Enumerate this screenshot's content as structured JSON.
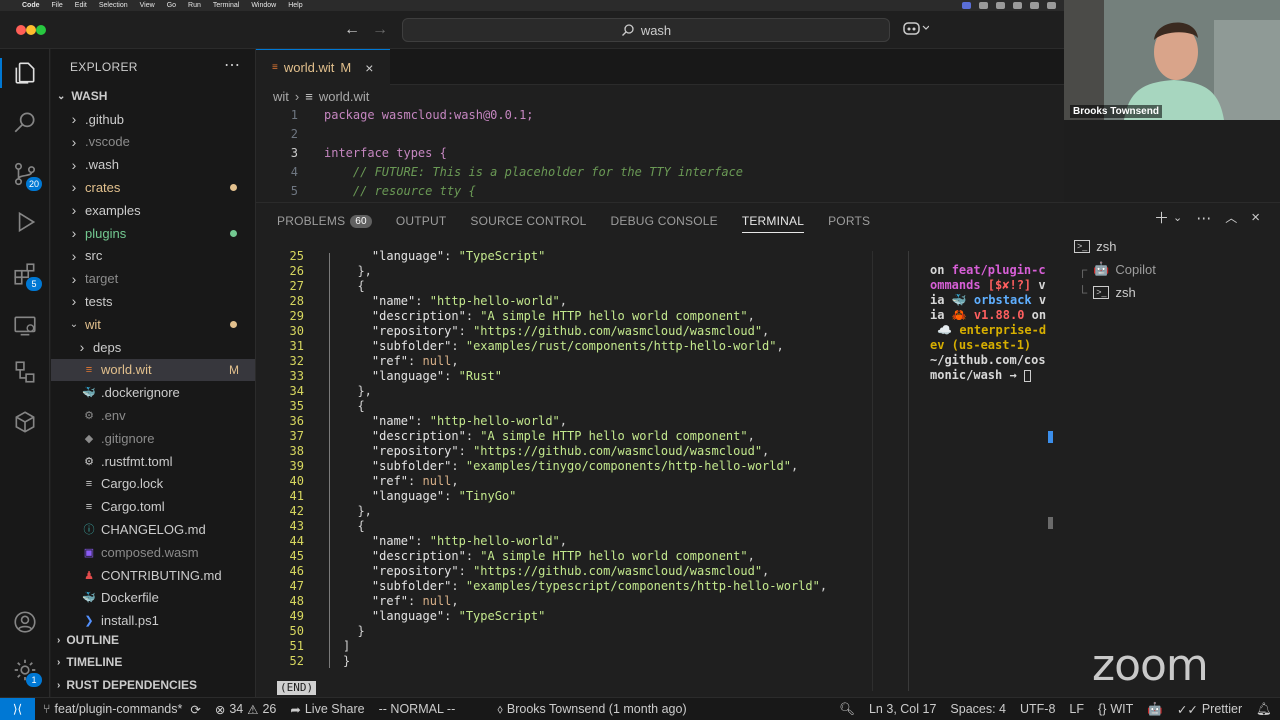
{
  "menubar": {
    "items": [
      "Code",
      "File",
      "Edit",
      "Selection",
      "View",
      "Go",
      "Run",
      "Terminal",
      "Window",
      "Help"
    ]
  },
  "titlebar": {
    "search_text": "wash"
  },
  "activity": {
    "source_control_badge": "20",
    "extensions_badge": "5",
    "manage_badge": "1"
  },
  "sidebar": {
    "title": "EXPLORER",
    "root": "WASH",
    "items": [
      {
        "label": ".github",
        "type": "folder",
        "color": "#cccccc"
      },
      {
        "label": ".vscode",
        "type": "folder",
        "color": "#8b8b8b"
      },
      {
        "label": ".wash",
        "type": "folder",
        "color": "#cccccc"
      },
      {
        "label": "crates",
        "type": "folder",
        "color": "#e2c08d"
      },
      {
        "label": "examples",
        "type": "folder",
        "color": "#cccccc"
      },
      {
        "label": "plugins",
        "type": "folder",
        "color": "#73c991"
      },
      {
        "label": "src",
        "type": "folder",
        "color": "#cccccc"
      },
      {
        "label": "target",
        "type": "folder",
        "color": "#8b8b8b"
      },
      {
        "label": "tests",
        "type": "folder",
        "color": "#cccccc"
      },
      {
        "label": "wit",
        "type": "folder-open",
        "color": "#e2c08d"
      },
      {
        "label": "deps",
        "type": "folder",
        "color": "#cccccc"
      },
      {
        "label": "world.wit",
        "type": "file",
        "color": "#e2c08d",
        "mark": "M"
      },
      {
        "label": ".dockerignore",
        "type": "file",
        "color": "#cccccc"
      },
      {
        "label": ".env",
        "type": "file",
        "color": "#8b8b8b"
      },
      {
        "label": ".gitignore",
        "type": "file",
        "color": "#8b8b8b"
      },
      {
        "label": ".rustfmt.toml",
        "type": "file",
        "color": "#cccccc"
      },
      {
        "label": "Cargo.lock",
        "type": "file",
        "color": "#cccccc"
      },
      {
        "label": "Cargo.toml",
        "type": "file",
        "color": "#cccccc"
      },
      {
        "label": "CHANGELOG.md",
        "type": "file",
        "color": "#cccccc"
      },
      {
        "label": "composed.wasm",
        "type": "file",
        "color": "#8b8b8b"
      },
      {
        "label": "CONTRIBUTING.md",
        "type": "file",
        "color": "#cccccc"
      },
      {
        "label": "Dockerfile",
        "type": "file",
        "color": "#cccccc"
      },
      {
        "label": "install.ps1",
        "type": "file",
        "color": "#cccccc"
      }
    ],
    "sections": [
      "OUTLINE",
      "TIMELINE",
      "RUST DEPENDENCIES"
    ]
  },
  "editor": {
    "tab_label": "world.wit",
    "tab_mark": "M",
    "breadcrumb": [
      "wit",
      "world.wit"
    ],
    "lines": [
      {
        "n": "1",
        "code": "package wasmcloud:wash@0.0.1;"
      },
      {
        "n": "2",
        "code": ""
      },
      {
        "n": "3",
        "code": "interface types {"
      },
      {
        "n": "4",
        "code": "    // FUTURE: This is a placeholder for the TTY interface"
      },
      {
        "n": "5",
        "code": "    // resource tty {"
      }
    ]
  },
  "panel": {
    "tabs": [
      {
        "label": "PROBLEMS",
        "badge": "60"
      },
      {
        "label": "OUTPUT"
      },
      {
        "label": "SOURCE CONTROL"
      },
      {
        "label": "DEBUG CONSOLE"
      },
      {
        "label": "TERMINAL",
        "active": true
      },
      {
        "label": "PORTS"
      }
    ],
    "terminal_lines": [
      {
        "n": "25",
        "code": "    \"language\": \"TypeScript\""
      },
      {
        "n": "26",
        "code": "  },"
      },
      {
        "n": "27",
        "code": "  {"
      },
      {
        "n": "28",
        "code": "    \"name\": \"http-hello-world\","
      },
      {
        "n": "29",
        "code": "    \"description\": \"A simple HTTP hello world component\","
      },
      {
        "n": "30",
        "code": "    \"repository\": \"https://github.com/wasmcloud/wasmcloud\","
      },
      {
        "n": "31",
        "code": "    \"subfolder\": \"examples/rust/components/http-hello-world\","
      },
      {
        "n": "32",
        "code": "    \"ref\": null,"
      },
      {
        "n": "33",
        "code": "    \"language\": \"Rust\""
      },
      {
        "n": "34",
        "code": "  },"
      },
      {
        "n": "35",
        "code": "  {"
      },
      {
        "n": "36",
        "code": "    \"name\": \"http-hello-world\","
      },
      {
        "n": "37",
        "code": "    \"description\": \"A simple HTTP hello world component\","
      },
      {
        "n": "38",
        "code": "    \"repository\": \"https://github.com/wasmcloud/wasmcloud\","
      },
      {
        "n": "39",
        "code": "    \"subfolder\": \"examples/tinygo/components/http-hello-world\","
      },
      {
        "n": "40",
        "code": "    \"ref\": null,"
      },
      {
        "n": "41",
        "code": "    \"language\": \"TinyGo\""
      },
      {
        "n": "42",
        "code": "  },"
      },
      {
        "n": "43",
        "code": "  {"
      },
      {
        "n": "44",
        "code": "    \"name\": \"http-hello-world\","
      },
      {
        "n": "45",
        "code": "    \"description\": \"A simple HTTP hello world component\","
      },
      {
        "n": "46",
        "code": "    \"repository\": \"https://github.com/wasmcloud/wasmcloud\","
      },
      {
        "n": "47",
        "code": "    \"subfolder\": \"examples/typescript/components/http-hello-world\","
      },
      {
        "n": "48",
        "code": "    \"ref\": null,"
      },
      {
        "n": "49",
        "code": "    \"language\": \"TypeScript\""
      },
      {
        "n": "50",
        "code": "  }"
      },
      {
        "n": "51",
        "code": "]"
      },
      {
        "n": "52",
        "code": "}"
      }
    ],
    "end_marker": "(END)",
    "prompt": {
      "l1a": "on ",
      "l1b": "feat/plugin-c",
      "l2a": "ommands",
      "l2b": " [$✘!?]",
      "l2c": " v",
      "l3a": "ia ",
      "l3b": "🐳 orbstack",
      "l3c": " v",
      "l4a": "ia ",
      "l4b": "🦀 v1.88.0",
      "l4c": " on",
      "l5a": " ☁️ ",
      "l5b": "enterprise-d",
      "l6a": "ev (us-east-1)",
      "l7a": "~/github.com/cos",
      "l8a": "monic/wash",
      "l8b": " → "
    },
    "terminals": [
      "zsh",
      "Copilot",
      "zsh"
    ]
  },
  "statusbar": {
    "branch": "feat/plugin-commands*",
    "errors": "34",
    "warnings": "26",
    "live_share": "Live Share",
    "vim_mode": "-- NORMAL --",
    "blame": "Brooks Townsend (1 month ago)",
    "position": "Ln 3, Col 17",
    "spaces": "Spaces: 4",
    "encoding": "UTF-8",
    "eol": "LF",
    "language": "WIT",
    "prettier": "Prettier"
  },
  "zoom": {
    "participant": "Brooks Townsend",
    "logo": "zoom"
  },
  "colors": {
    "accent": "#0078d4",
    "modified": "#e2c08d",
    "untracked": "#73c991"
  }
}
